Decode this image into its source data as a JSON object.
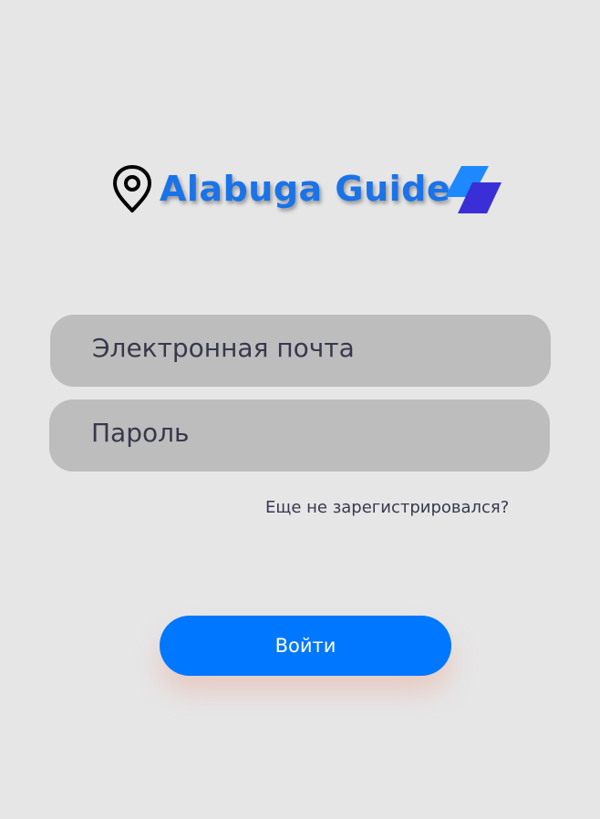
{
  "logo": {
    "title": "Alabuga Guide",
    "pin_icon": "map-pin-icon",
    "mark_icon": "brand-parallelogram-icon",
    "text_color": "#1a73e8"
  },
  "form": {
    "email_placeholder": "Электронная почта",
    "password_placeholder": "Пароль",
    "register_link": "Еще не зарегистрировался?",
    "submit_label": "Войти"
  },
  "colors": {
    "background": "#e6e6e7",
    "field_bg": "#bdbdbd",
    "field_text": "#38384c",
    "button_bg": "#0077ff",
    "button_text": "#ffffff",
    "mark_light": "#1e88ff",
    "mark_dark": "#3a2fd6"
  }
}
